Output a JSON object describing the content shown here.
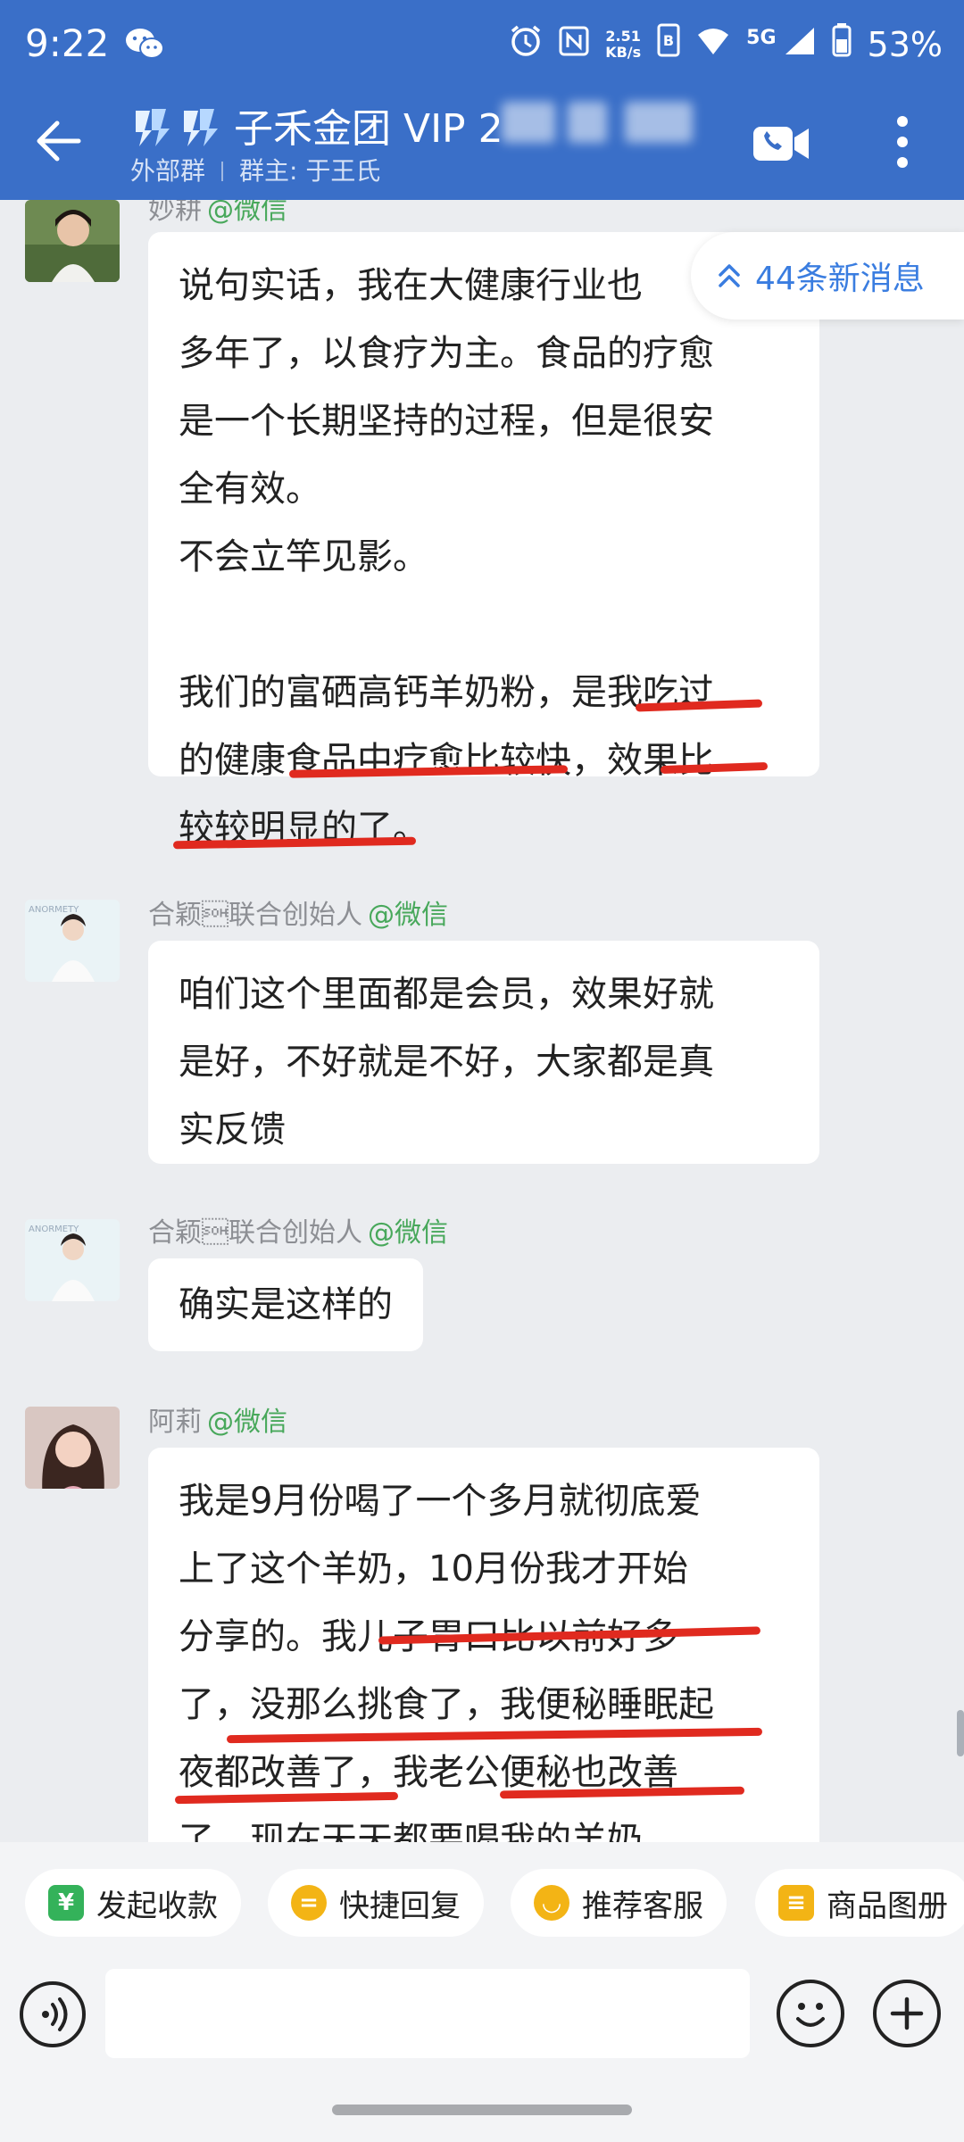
{
  "status_bar": {
    "time": "9:22",
    "net_speed_value": "2.51",
    "net_speed_unit": "KB/s",
    "network": "5G",
    "battery": "53%",
    "icons": [
      "wechat-icon",
      "alarm-icon",
      "nfc-icon",
      "hd-icon",
      "wifi-icon",
      "signal-icon",
      "battery-icon"
    ]
  },
  "header": {
    "title": "子禾金团 VIP 2",
    "subtitle_type": "外部群",
    "subtitle_owner": "群主: 于王氏",
    "accent_color": "#3a6fc8"
  },
  "new_messages_label": "44条新消息",
  "messages": [
    {
      "sender": "妙耕",
      "source": "@微信",
      "lines": [
        "说句实话，我在大健康行业也",
        "多年了，以食疗为主。食品的疗愈",
        "是一个长期坚持的过程，但是很安",
        "全有效。",
        "不会立竿见影。",
        "",
        "我们的富硒高钙羊奶粉，是我吃过",
        "的健康食品中疗愈比较快，效果比",
        "较较明显的了。"
      ]
    },
    {
      "sender": "合颖\u0001联合创始人",
      "source": "@微信",
      "lines": [
        "咱们这个里面都是会员，效果好就",
        "是好，不好就是不好，大家都是真",
        "实反馈"
      ]
    },
    {
      "sender": "合颖\u0001联合创始人",
      "source": "@微信",
      "lines": [
        "确实是这样的"
      ]
    },
    {
      "sender": "阿莉",
      "source": "@微信",
      "lines": [
        "我是9月份喝了一个多月就彻底爱",
        "上了这个羊奶，10月份我才开始",
        "分享的。我儿子胃口比以前好多",
        "了，没那么挑食了，我便秘睡眠起",
        "夜都改善了，我老公便秘也改善",
        "了，现在天天都要喝我的羊奶"
      ]
    }
  ],
  "quick_actions": [
    {
      "label": "发起收款",
      "icon": "yuan-icon",
      "color": "#34b25a",
      "glyph": "¥"
    },
    {
      "label": "快捷回复",
      "icon": "quick-reply-icon",
      "color": "#f3b415",
      "glyph": "="
    },
    {
      "label": "推荐客服",
      "icon": "service-icon",
      "color": "#f3b415",
      "glyph": "◡"
    },
    {
      "label": "商品图册",
      "icon": "catalog-icon",
      "color": "#f3b415",
      "glyph": "≡"
    }
  ],
  "input": {
    "placeholder": ""
  }
}
